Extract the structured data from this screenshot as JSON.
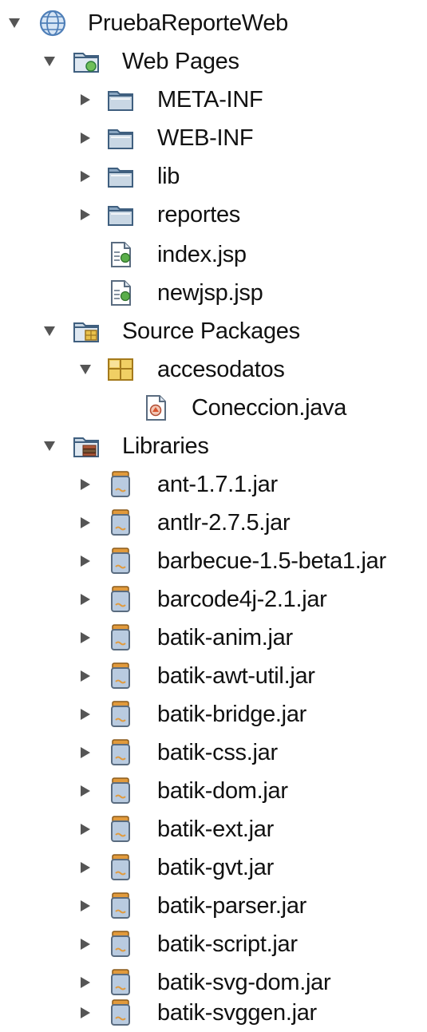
{
  "tree": {
    "project": {
      "label": "PruebaReporteWeb",
      "icon": "globe-icon"
    },
    "web_pages": {
      "label": "Web Pages",
      "icon": "web-pages-folder-icon",
      "children": [
        {
          "label": "META-INF",
          "icon": "folder-icon"
        },
        {
          "label": "WEB-INF",
          "icon": "folder-icon"
        },
        {
          "label": "lib",
          "icon": "folder-icon"
        },
        {
          "label": "reportes",
          "icon": "folder-icon"
        },
        {
          "label": "index.jsp",
          "icon": "jsp-file-icon"
        },
        {
          "label": "newjsp.jsp",
          "icon": "jsp-file-icon"
        }
      ]
    },
    "source_packages": {
      "label": "Source Packages",
      "icon": "source-packages-folder-icon",
      "package": {
        "label": "accesodatos",
        "icon": "package-icon"
      },
      "files": [
        {
          "label": "Coneccion.java",
          "icon": "java-file-icon"
        }
      ]
    },
    "libraries": {
      "label": "Libraries",
      "icon": "libraries-folder-icon",
      "jars": [
        "ant-1.7.1.jar",
        "antlr-2.7.5.jar",
        "barbecue-1.5-beta1.jar",
        "barcode4j-2.1.jar",
        "batik-anim.jar",
        "batik-awt-util.jar",
        "batik-bridge.jar",
        "batik-css.jar",
        "batik-dom.jar",
        "batik-ext.jar",
        "batik-gvt.jar",
        "batik-parser.jar",
        "batik-script.jar",
        "batik-svg-dom.jar",
        "batik-svggen.jar"
      ]
    }
  },
  "colors": {
    "arrow": "#555555",
    "folder_dark": "#3f5f7f",
    "folder_light": "#c9d7e4",
    "package_yellow": "#e8c04a",
    "jar_orange": "#e19a3c",
    "jar_body": "#b9cbe0",
    "globe": "#4f7fb8"
  }
}
